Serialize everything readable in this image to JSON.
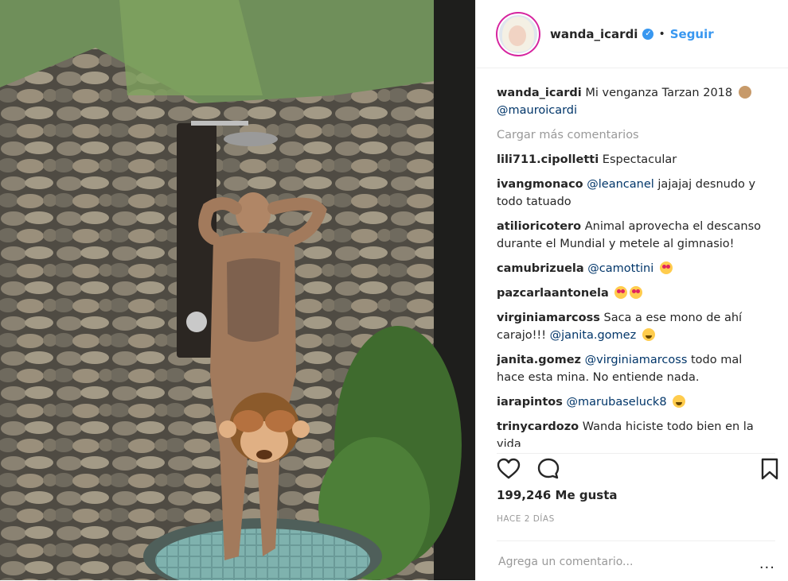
{
  "post": {
    "author": {
      "username": "wanda_icardi",
      "verified_icon": "verified-badge-icon",
      "separator": "•",
      "follow_label": "Seguir"
    },
    "caption": {
      "username": "wanda_icardi",
      "text": "Mi venganza Tarzan 2018",
      "mention": "@mauroicardi"
    },
    "load_more_label": "Cargar más comentarios",
    "comments": [
      {
        "user": "lili711.cipolletti",
        "mention": "",
        "text": "Espectacular",
        "emoji": ""
      },
      {
        "user": "ivangmonaco",
        "mention": "@leancanel",
        "text": "jajajaj desnudo y todo tatuado",
        "emoji": ""
      },
      {
        "user": "atilioricotero",
        "mention": "",
        "text": "Animal aprovecha el descanso durante el Mundial y metele al gimnasio!",
        "emoji": ""
      },
      {
        "user": "camubrizuela",
        "mention": "@camottini",
        "text": "",
        "emoji": "heart-eyes"
      },
      {
        "user": "pazcarlaantonela",
        "mention": "",
        "text": "",
        "emoji": "heart-eyes-x2"
      },
      {
        "user": "virginiamarcoss",
        "mention": "",
        "text": "Saca a ese mono de ahí carajo!!!",
        "mention2": "@janita.gomez",
        "emoji": "tears-of-joy"
      },
      {
        "user": "janita.gomez",
        "mention": "@virginiamarcoss",
        "text": "todo mal hace esta mina. No entiende nada.",
        "emoji": ""
      },
      {
        "user": "iarapintos",
        "mention": "@marubaseluck8",
        "text": "",
        "emoji": "tears-of-joy"
      },
      {
        "user": "trinycardozo",
        "mention": "",
        "text": "Wanda hiciste todo bien en la vida",
        "emoji": ""
      }
    ],
    "actions": {
      "like_icon": "heart-icon",
      "comment_icon": "comment-icon",
      "save_icon": "bookmark-icon"
    },
    "likes": "199,246 Me gusta",
    "timestamp": "HACE 2 DÍAS",
    "add_comment_placeholder": "Agrega un comentario...",
    "options_label": "..."
  },
  "colors": {
    "link_blue": "#3897f0",
    "mention_blue": "#003569",
    "muted_gray": "#999999",
    "border": "#efefef"
  }
}
